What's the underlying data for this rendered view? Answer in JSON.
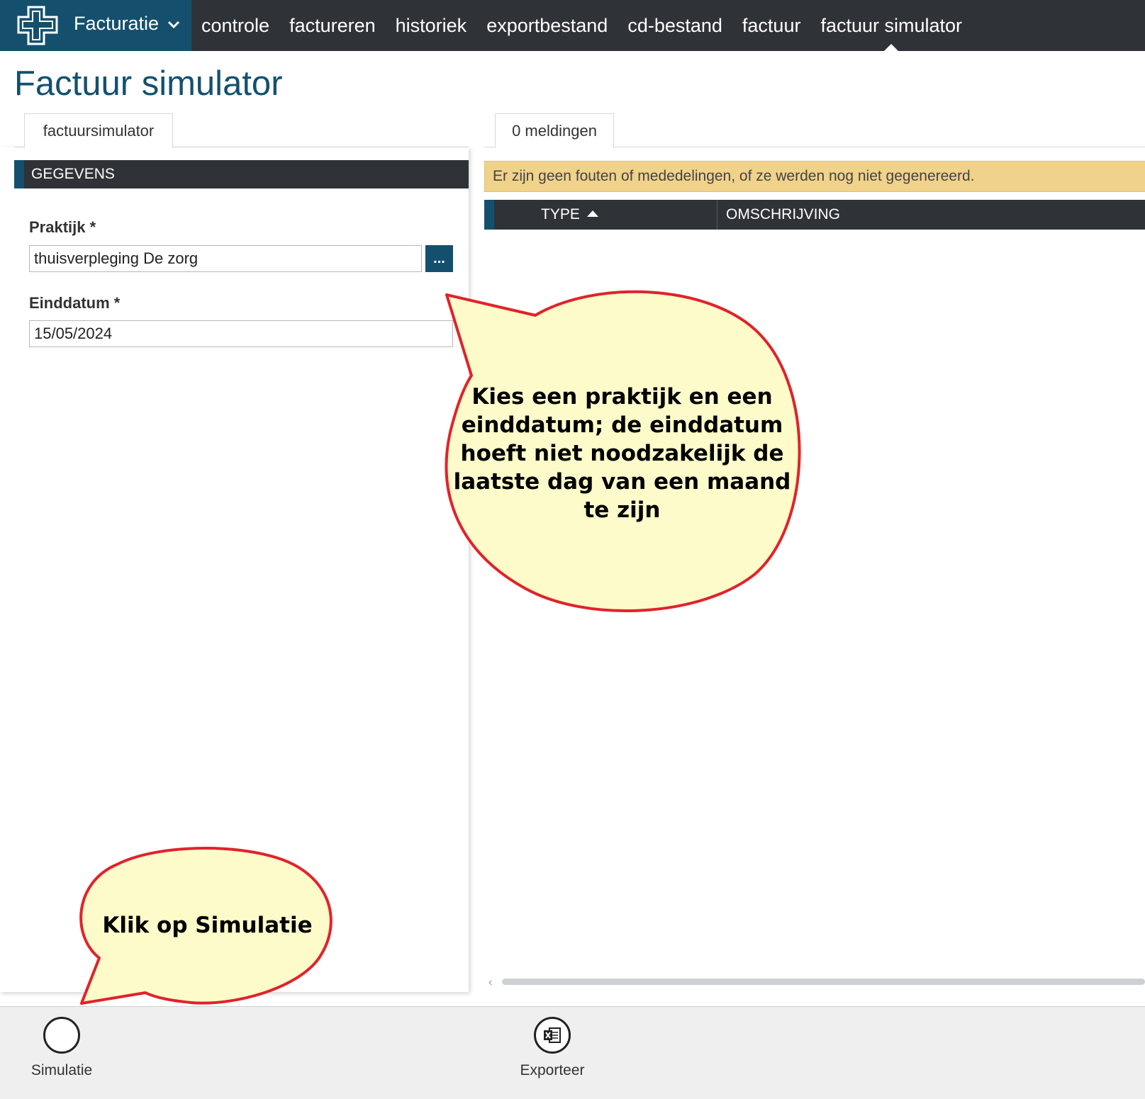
{
  "nav": {
    "brand_label": "Facturatie",
    "items": [
      {
        "label": "controle"
      },
      {
        "label": "factureren"
      },
      {
        "label": "historiek"
      },
      {
        "label": "exportbestand"
      },
      {
        "label": "cd-bestand"
      },
      {
        "label": "factuur"
      },
      {
        "label": "factuur simulator",
        "active": true
      }
    ]
  },
  "page": {
    "title": "Factuur simulator"
  },
  "left": {
    "tab_label": "factuursimulator",
    "section_title": "GEGEVENS",
    "praktijk": {
      "label": "Praktijk *",
      "value": "thuisverpleging De zorg",
      "lookup_label": "..."
    },
    "einddatum": {
      "label": "Einddatum *",
      "value": "15/05/2024"
    }
  },
  "right": {
    "tab_label": "0 meldingen",
    "notice": "Er zijn geen fouten of mededelingen, of ze werden nog niet gegenereerd.",
    "columns": [
      "TYPE",
      "OMSCHRIJVING"
    ],
    "rows": []
  },
  "toolbar": {
    "simulatie_label": "Simulatie",
    "exporteer_label": "Exporteer"
  },
  "callouts": {
    "main_lines": [
      "Kies een praktijk en een",
      "einddatum; de einddatum",
      "hoeft niet noodzakelijk de",
      "laatste dag van een maand",
      "te zijn"
    ],
    "bottom": "Klik op Simulatie"
  },
  "colors": {
    "brand": "#14506e",
    "nav_bg": "#2f3237",
    "notice_bg": "#f1d28a",
    "callout_fill": "#fdfbca",
    "callout_stroke": "#e0232b"
  }
}
